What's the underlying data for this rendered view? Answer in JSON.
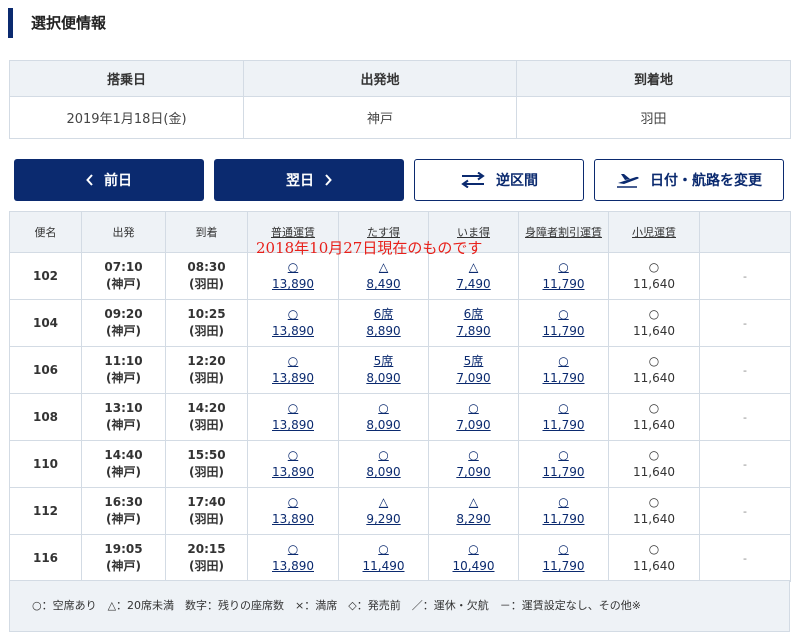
{
  "section_title": "選択便情報",
  "info": {
    "headers": [
      "搭乗日",
      "出発地",
      "到着地"
    ],
    "values": [
      "2019年1月18日(金)",
      "神戸",
      "羽田"
    ]
  },
  "buttons": {
    "prev_day": "前日",
    "next_day": "翌日",
    "reverse": "逆区間",
    "change": "日付・航路を変更"
  },
  "overlay_note": "2018年10月27日現在のものです",
  "table": {
    "headers": [
      "便名",
      "出発",
      "到着",
      "普通運賃",
      "たす得",
      "いま得",
      "身障者割引運賃",
      "小児運賃",
      ""
    ],
    "rows": [
      {
        "flight": "102",
        "dep_time": "07:10",
        "dep_place": "(神戸)",
        "arr_time": "08:30",
        "arr_place": "(羽田)",
        "fares": [
          {
            "seat": "○",
            "price": "13,890"
          },
          {
            "seat": "△",
            "price": "8,490"
          },
          {
            "seat": "△",
            "price": "7,490"
          },
          {
            "seat": "○",
            "price": "11,790"
          },
          {
            "seat": "○",
            "price": "11,640"
          }
        ],
        "extra": "-"
      },
      {
        "flight": "104",
        "dep_time": "09:20",
        "dep_place": "(神戸)",
        "arr_time": "10:25",
        "arr_place": "(羽田)",
        "fares": [
          {
            "seat": "○",
            "price": "13,890"
          },
          {
            "seat": "6席",
            "price": "8,890"
          },
          {
            "seat": "6席",
            "price": "7,890"
          },
          {
            "seat": "○",
            "price": "11,790"
          },
          {
            "seat": "○",
            "price": "11,640"
          }
        ],
        "extra": "-"
      },
      {
        "flight": "106",
        "dep_time": "11:10",
        "dep_place": "(神戸)",
        "arr_time": "12:20",
        "arr_place": "(羽田)",
        "fares": [
          {
            "seat": "○",
            "price": "13,890"
          },
          {
            "seat": "5席",
            "price": "8,090"
          },
          {
            "seat": "5席",
            "price": "7,090"
          },
          {
            "seat": "○",
            "price": "11,790"
          },
          {
            "seat": "○",
            "price": "11,640"
          }
        ],
        "extra": "-"
      },
      {
        "flight": "108",
        "dep_time": "13:10",
        "dep_place": "(神戸)",
        "arr_time": "14:20",
        "arr_place": "(羽田)",
        "fares": [
          {
            "seat": "○",
            "price": "13,890"
          },
          {
            "seat": "○",
            "price": "8,090"
          },
          {
            "seat": "○",
            "price": "7,090"
          },
          {
            "seat": "○",
            "price": "11,790"
          },
          {
            "seat": "○",
            "price": "11,640"
          }
        ],
        "extra": "-"
      },
      {
        "flight": "110",
        "dep_time": "14:40",
        "dep_place": "(神戸)",
        "arr_time": "15:50",
        "arr_place": "(羽田)",
        "fares": [
          {
            "seat": "○",
            "price": "13,890"
          },
          {
            "seat": "○",
            "price": "8,090"
          },
          {
            "seat": "○",
            "price": "7,090"
          },
          {
            "seat": "○",
            "price": "11,790"
          },
          {
            "seat": "○",
            "price": "11,640"
          }
        ],
        "extra": "-"
      },
      {
        "flight": "112",
        "dep_time": "16:30",
        "dep_place": "(神戸)",
        "arr_time": "17:40",
        "arr_place": "(羽田)",
        "fares": [
          {
            "seat": "○",
            "price": "13,890"
          },
          {
            "seat": "△",
            "price": "9,290"
          },
          {
            "seat": "△",
            "price": "8,290"
          },
          {
            "seat": "○",
            "price": "11,790"
          },
          {
            "seat": "○",
            "price": "11,640"
          }
        ],
        "extra": "-"
      },
      {
        "flight": "116",
        "dep_time": "19:05",
        "dep_place": "(神戸)",
        "arr_time": "20:15",
        "arr_place": "(羽田)",
        "fares": [
          {
            "seat": "○",
            "price": "13,890"
          },
          {
            "seat": "○",
            "price": "11,490"
          },
          {
            "seat": "○",
            "price": "10,490"
          },
          {
            "seat": "○",
            "price": "11,790"
          },
          {
            "seat": "○",
            "price": "11,640"
          }
        ],
        "extra": "-"
      }
    ]
  },
  "legend": "○：空席あり　△：20席未満　数字：残りの座席数　×：満席　◇：発売前　／：運休・欠航　－：運賃設定なし、その他※",
  "colors": {
    "brand": "#0b2a6f",
    "header_bg": "#eef2f6",
    "note_red": "#e8201a"
  }
}
